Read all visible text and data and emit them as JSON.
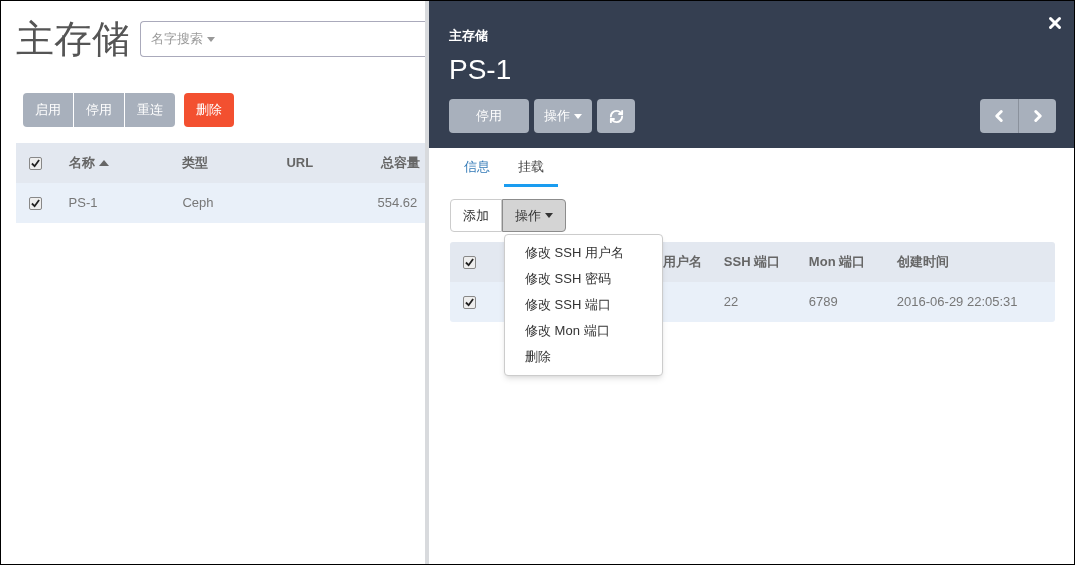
{
  "page": {
    "title": "主存储",
    "search_filter": "名字搜索",
    "actions": [
      {
        "label": "启用",
        "kind": "group"
      },
      {
        "label": "停用",
        "kind": "group"
      },
      {
        "label": "重连",
        "kind": "group"
      },
      {
        "label": "删除",
        "kind": "danger"
      }
    ],
    "table": {
      "select_all": {
        "checked": true
      },
      "columns": [
        {
          "label": "名称",
          "sorted": true
        },
        {
          "label": "类型",
          "sorted": false
        },
        {
          "label": "URL",
          "sorted": false
        },
        {
          "label": "总容量",
          "sorted": false
        }
      ],
      "rows": [
        {
          "checked": true,
          "name": "PS-1",
          "type": "Ceph",
          "total_capacity": "554.62"
        }
      ]
    }
  },
  "detail_panel": {
    "subtitle": "主存储",
    "title": "PS-1",
    "buttons": [
      {
        "kind": "text",
        "label": "停用"
      },
      {
        "kind": "dropdown",
        "label": "操作"
      },
      {
        "kind": "refresh"
      }
    ],
    "nav": [
      {
        "kind": "prev"
      },
      {
        "kind": "next"
      }
    ],
    "tabs": [
      {
        "label": "信息",
        "selected": false
      },
      {
        "label": "挂载",
        "selected": true
      }
    ],
    "toolbar": [
      {
        "label": "添加",
        "pressed": false,
        "dropdown": false
      },
      {
        "label": "操作",
        "pressed": true,
        "dropdown": true
      }
    ],
    "menu": [
      "修改 SSH 用户名",
      "修改 SSH 密码",
      "修改 SSH 端口",
      "修改 Mon 端口",
      "删除"
    ],
    "table": {
      "select_all": {
        "checked": true
      },
      "columns": [
        "用户名",
        "SSH 端口",
        "Mon 端口",
        "创建时间"
      ],
      "rows": [
        {
          "checked": true,
          "ssh_port": "22",
          "mon_port": "6789",
          "created": "2016-06-29 22:05:31"
        }
      ]
    }
  }
}
